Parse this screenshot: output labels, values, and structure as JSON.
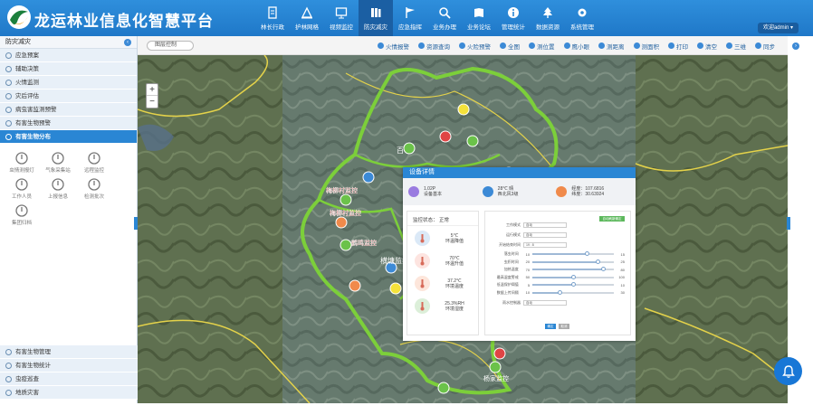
{
  "app": {
    "title": "龙运林业信息化智慧平台",
    "user_label": "欢迎admin ▾"
  },
  "nav": [
    {
      "label": "林长行政",
      "icon": "document-icon"
    },
    {
      "label": "护林网格",
      "icon": "grid-icon"
    },
    {
      "label": "视频监控",
      "icon": "monitor-icon"
    },
    {
      "label": "防灾减灾",
      "icon": "books-icon",
      "active": true
    },
    {
      "label": "应急指挥",
      "icon": "flag-icon"
    },
    {
      "label": "业务办理",
      "icon": "search-icon"
    },
    {
      "label": "业务论坛",
      "icon": "book-icon"
    },
    {
      "label": "管理统计",
      "icon": "info-icon"
    },
    {
      "label": "数据资源",
      "icon": "tree-icon"
    },
    {
      "label": "系统管理",
      "icon": "gear-icon"
    }
  ],
  "sidebar": {
    "header": "防灾减灾",
    "menu": [
      {
        "label": "应急预案"
      },
      {
        "label": "辅助决策"
      },
      {
        "label": "火情监测"
      },
      {
        "label": "灾后评估"
      },
      {
        "label": "病虫害监测预警"
      },
      {
        "label": "有害生物预警"
      },
      {
        "label": "有害生物分布",
        "active": true
      }
    ],
    "tools": [
      {
        "label": "虫情测报灯",
        "icon": "bug-lamp-icon"
      },
      {
        "label": "气象采集站",
        "icon": "thermometer-icon"
      },
      {
        "label": "远程监控",
        "icon": "camera-icon"
      },
      {
        "label": "工作人员",
        "icon": "people-icon"
      },
      {
        "label": "上报信息",
        "icon": "upload-cloud-icon"
      },
      {
        "label": "检测批次",
        "icon": "batch-icon"
      },
      {
        "label": "集团归档",
        "icon": "archive-icon"
      }
    ],
    "bottom_menu": [
      {
        "label": "有害生物管理"
      },
      {
        "label": "有害生物统计"
      },
      {
        "label": "虫疫巡查"
      },
      {
        "label": "地质灾害"
      }
    ]
  },
  "toolbar": {
    "layer_select": "图层控制",
    "buttons": [
      {
        "label": "火情报警"
      },
      {
        "label": "资源查询"
      },
      {
        "label": "火险预警"
      },
      {
        "label": "全图"
      },
      {
        "label": "测位置"
      },
      {
        "label": "鹰小眼"
      },
      {
        "label": "测距离"
      },
      {
        "label": "测面积"
      },
      {
        "label": "打印"
      },
      {
        "label": "清空"
      },
      {
        "label": "三维"
      },
      {
        "label": "同步"
      }
    ]
  },
  "map": {
    "labels": [
      "百",
      "梅柳村监控",
      "梅柳村监控",
      "鹤鸣监控",
      "横塘监控",
      "杨家监控"
    ],
    "zoom_in": "+",
    "zoom_out": "−"
  },
  "modal": {
    "title": "设备详情",
    "stats": [
      {
        "line1": "1.02P",
        "line2": "设备基本",
        "color": "#9a7be0"
      },
      {
        "line1": "28℃ 晴",
        "line2": "西北风3级",
        "color": "#3c8ad6"
      },
      {
        "line1": "经度：107.6816",
        "line2": "纬度：30.63924",
        "color": "#f08a4b"
      }
    ],
    "status_label": "监控状态：",
    "status_value": "正常",
    "readings": [
      {
        "value": "5℃",
        "label": "环温降值",
        "color": "#dbe9f7"
      },
      {
        "value": "70℃",
        "label": "环温升值",
        "color": "#fde4e0"
      },
      {
        "value": "37.2℃",
        "label": "环境温度",
        "color": "#fde6db"
      },
      {
        "value": "25.3%RH",
        "label": "环境湿度",
        "color": "#dcefd9"
      }
    ],
    "save_label": "自动刷新确定",
    "fields": [
      {
        "label": "工作模式",
        "value": "自动"
      },
      {
        "label": "运行模式",
        "value": "自动"
      },
      {
        "label": "开始结束时间",
        "value": "19 : 8"
      }
    ],
    "sliders": [
      {
        "label": "落虫时间",
        "value": 10,
        "max": 15
      },
      {
        "label": "虫积时间",
        "value": 20,
        "max": 25
      },
      {
        "label": "加热温度",
        "value": 70,
        "max": 80
      },
      {
        "label": "最高湿度警戒",
        "value": 50,
        "max": 100
      },
      {
        "label": "低温保护阈值",
        "value": 5,
        "max": 10
      },
      {
        "label": "数据上传间隔",
        "value": 10,
        "max": 30
      }
    ],
    "last_field": {
      "label": "雨水控制器",
      "value": "自动"
    },
    "btn_ok": "确定",
    "btn_cancel": "取消"
  }
}
